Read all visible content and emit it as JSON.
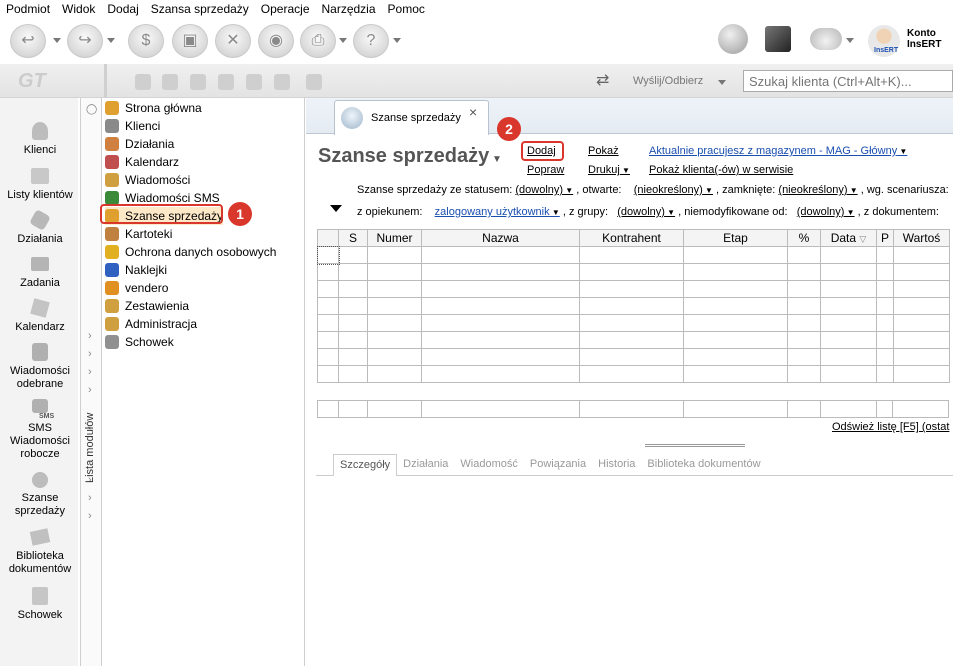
{
  "menu": [
    "Podmiot",
    "Widok",
    "Dodaj",
    "Szansa sprzedaży",
    "Operacje",
    "Narzędzia",
    "Pomoc"
  ],
  "account": {
    "label": "Konto",
    "name": "InsERT",
    "avatar_caption": "InsERT"
  },
  "topbar": {
    "send_receive": "Wyślij/Odbierz",
    "search_placeholder": "Szukaj klienta (Ctrl+Alt+K)..."
  },
  "left_column": [
    {
      "label": "Klienci",
      "icon": "clients-icon"
    },
    {
      "label": "Listy klientów",
      "icon": "client-lists-icon"
    },
    {
      "label": "Działania",
      "icon": "actions-icon"
    },
    {
      "label": "Zadania",
      "icon": "tasks-icon"
    },
    {
      "label": "Kalendarz",
      "icon": "calendar-icon"
    },
    {
      "label": "Wiadomości odebrane",
      "icon": "inbox-icon"
    },
    {
      "label": "SMS Wiadomości robocze",
      "icon": "sms-drafts-icon",
      "sub": "SMS"
    },
    {
      "label": "Szanse sprzedaży",
      "icon": "sales-opportunities-icon"
    },
    {
      "label": "Biblioteka dokumentów",
      "icon": "document-library-icon"
    },
    {
      "label": "Schowek",
      "icon": "clipboard-icon"
    }
  ],
  "module_strip_label": "Lista modułów",
  "tree": [
    {
      "label": "Strona główna",
      "color": "#e0a030"
    },
    {
      "label": "Klienci",
      "color": "#8a8a8a"
    },
    {
      "label": "Działania",
      "color": "#d08040"
    },
    {
      "label": "Kalendarz",
      "color": "#c05050"
    },
    {
      "label": "Wiadomości",
      "color": "#d0a040"
    },
    {
      "label": "Wiadomości SMS",
      "color": "#3a8a3a"
    },
    {
      "label": "Szanse sprzedaży",
      "color": "#e0a030"
    },
    {
      "label": "Kartoteki",
      "color": "#c08040"
    },
    {
      "label": "Ochrona danych osobowych",
      "color": "#e0b020"
    },
    {
      "label": "Naklejki",
      "color": "#3060c0"
    },
    {
      "label": "vendero",
      "color": "#e09020"
    },
    {
      "label": "Zestawienia",
      "color": "#d0a040"
    },
    {
      "label": "Administracja",
      "color": "#d0a040"
    },
    {
      "label": "Schowek",
      "color": "#909090"
    }
  ],
  "tab": {
    "label": "Szanse sprzedaży",
    "close": "×"
  },
  "page": {
    "title": "Szanse sprzedaży"
  },
  "actions": {
    "add": "Dodaj",
    "edit": "Popraw",
    "show": "Pokaż",
    "print": "Drukuj",
    "warehouse_link": "Aktualnie pracujesz z magazynem - MAG - Główny",
    "show_clients": "Pokaż klienta(-ów) w serwisie"
  },
  "filters": {
    "row1": {
      "status_label": "Szanse sprzedaży ze statusem:",
      "status_value": "(dowolny)",
      "open_label": ", otwarte:",
      "open_value": "(nieokreślony)",
      "closed_label": ", zamknięte:",
      "closed_value": "(nieokreślony)",
      "scenario_label": ", wg. scenariusza:"
    },
    "row2": {
      "owner_label": "z opiekunem:",
      "owner_value": "zalogowany użytkownik",
      "group_label": ", z grupy:",
      "group_value": "(dowolny)",
      "unmodified_label": ", niemodyfikowane od:",
      "unmodified_value": "(dowolny)",
      "docs_label": ", z dokumentem:"
    }
  },
  "grid": {
    "columns": [
      "",
      "S",
      "Numer",
      "Nazwa",
      "Kontrahent",
      "Etap",
      "%",
      "Data",
      "P",
      "Wartoś"
    ],
    "sort_indicator": "▽"
  },
  "refresh": "Odśwież listę [F5] (ostat",
  "bottom_tabs": [
    "Szczegóły",
    "Działania",
    "Wiadomość",
    "Powiązania",
    "Historia",
    "Biblioteka dokumentów"
  ],
  "badges": [
    "1",
    "2"
  ],
  "colors": {
    "highlight": "#d9362c",
    "link": "#1a4fb0"
  }
}
